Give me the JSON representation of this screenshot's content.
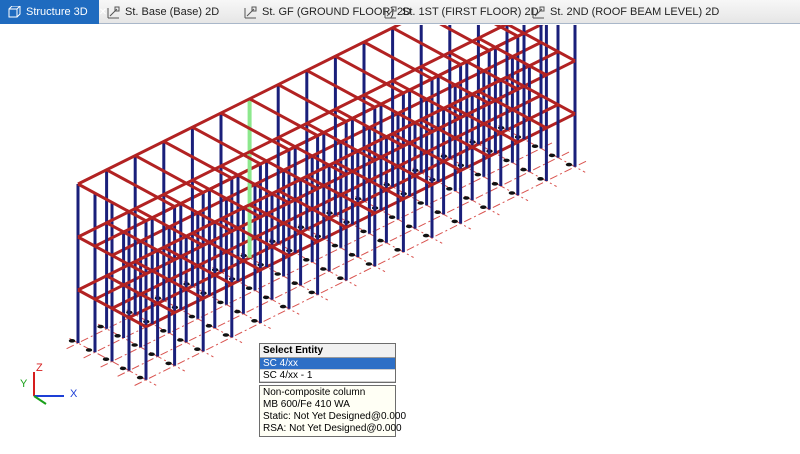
{
  "tabs": [
    {
      "label": "Structure 3D",
      "active": true,
      "close": "✕"
    },
    {
      "label": "St. Base (Base) 2D",
      "active": false
    },
    {
      "label": "St. GF (GROUND FLOOR) 2D",
      "active": false
    },
    {
      "label": "St. 1ST (FIRST FLOOR) 2D",
      "active": false
    },
    {
      "label": "St. 2ND (ROOF BEAM LEVEL) 2D",
      "active": false
    }
  ],
  "select_entity": {
    "title": "Select Entity",
    "items": [
      "SC 4/xx",
      "SC 4/xx - 1"
    ],
    "selected_index": 0
  },
  "info": {
    "lines": [
      "Non-composite column",
      "MB 600/Fe 410 WA",
      "Static: Not Yet Designed@0.000",
      "RSA: Not Yet Designed@0.000"
    ]
  },
  "axes": {
    "x": "X",
    "y": "Y",
    "z": "Z",
    "x_color": "#1d3fd6",
    "y_color": "#1aa01a",
    "z_color": "#d61d1d"
  },
  "colors": {
    "beam": "#b22222",
    "beam_highlight": "#e04040",
    "column": "#1a1f7a",
    "column_selected": "#8de88d",
    "gridline": "#d9534f",
    "tab_active": "#1f6bbf"
  }
}
